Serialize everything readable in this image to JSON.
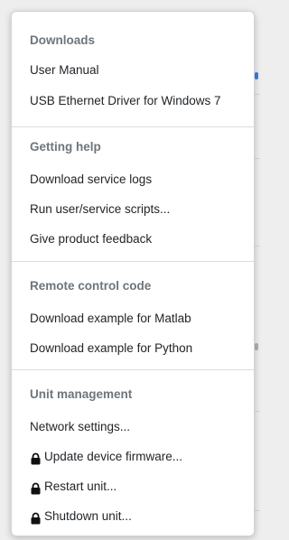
{
  "menu": {
    "sections": [
      {
        "header": "Downloads",
        "items": [
          {
            "label": "User Manual",
            "locked": false
          },
          {
            "label": "USB Ethernet Driver for Windows 7",
            "locked": false
          }
        ]
      },
      {
        "header": "Getting help",
        "items": [
          {
            "label": "Download service logs",
            "locked": false
          },
          {
            "label": "Run user/service scripts...",
            "locked": false
          },
          {
            "label": "Give product feedback",
            "locked": false
          }
        ]
      },
      {
        "header": "Remote control code",
        "items": [
          {
            "label": "Download example for Matlab",
            "locked": false
          },
          {
            "label": "Download example for Python",
            "locked": false
          }
        ]
      },
      {
        "header": "Unit management",
        "items": [
          {
            "label": "Network settings...",
            "locked": false
          },
          {
            "label": "Update device firmware...",
            "locked": true
          },
          {
            "label": "Restart unit...",
            "locked": true
          },
          {
            "label": "Shutdown unit...",
            "locked": true
          }
        ]
      }
    ]
  },
  "colors": {
    "header_text": "#6c757d",
    "item_text": "#212529",
    "divider": "#dcdcdc",
    "lock_icon": "#111111"
  }
}
